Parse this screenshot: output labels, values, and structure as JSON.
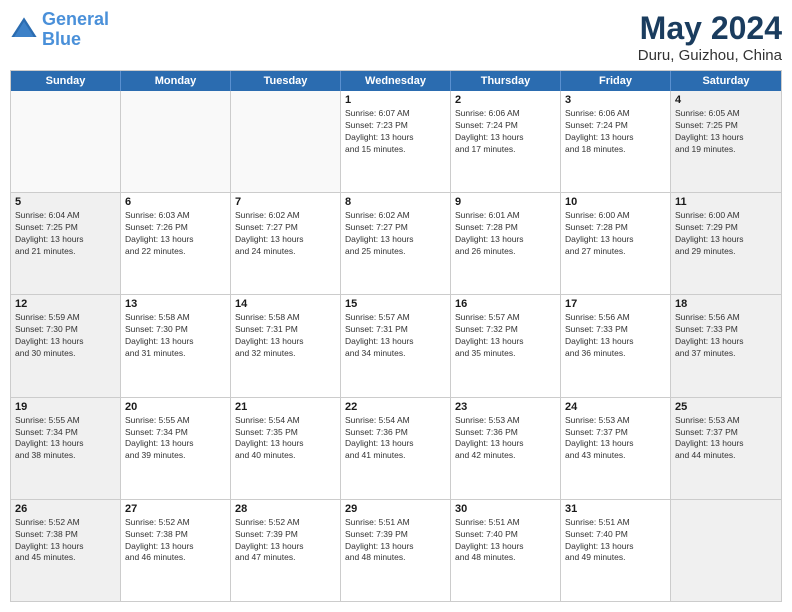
{
  "header": {
    "logo_line1": "General",
    "logo_line2": "Blue",
    "month": "May 2024",
    "location": "Duru, Guizhou, China"
  },
  "weekdays": [
    "Sunday",
    "Monday",
    "Tuesday",
    "Wednesday",
    "Thursday",
    "Friday",
    "Saturday"
  ],
  "rows": [
    [
      {
        "day": "",
        "info": "",
        "shaded": false,
        "empty": true
      },
      {
        "day": "",
        "info": "",
        "shaded": false,
        "empty": true
      },
      {
        "day": "",
        "info": "",
        "shaded": false,
        "empty": true
      },
      {
        "day": "1",
        "info": "Sunrise: 6:07 AM\nSunset: 7:23 PM\nDaylight: 13 hours\nand 15 minutes.",
        "shaded": false,
        "empty": false
      },
      {
        "day": "2",
        "info": "Sunrise: 6:06 AM\nSunset: 7:24 PM\nDaylight: 13 hours\nand 17 minutes.",
        "shaded": false,
        "empty": false
      },
      {
        "day": "3",
        "info": "Sunrise: 6:06 AM\nSunset: 7:24 PM\nDaylight: 13 hours\nand 18 minutes.",
        "shaded": false,
        "empty": false
      },
      {
        "day": "4",
        "info": "Sunrise: 6:05 AM\nSunset: 7:25 PM\nDaylight: 13 hours\nand 19 minutes.",
        "shaded": true,
        "empty": false
      }
    ],
    [
      {
        "day": "5",
        "info": "Sunrise: 6:04 AM\nSunset: 7:25 PM\nDaylight: 13 hours\nand 21 minutes.",
        "shaded": true,
        "empty": false
      },
      {
        "day": "6",
        "info": "Sunrise: 6:03 AM\nSunset: 7:26 PM\nDaylight: 13 hours\nand 22 minutes.",
        "shaded": false,
        "empty": false
      },
      {
        "day": "7",
        "info": "Sunrise: 6:02 AM\nSunset: 7:27 PM\nDaylight: 13 hours\nand 24 minutes.",
        "shaded": false,
        "empty": false
      },
      {
        "day": "8",
        "info": "Sunrise: 6:02 AM\nSunset: 7:27 PM\nDaylight: 13 hours\nand 25 minutes.",
        "shaded": false,
        "empty": false
      },
      {
        "day": "9",
        "info": "Sunrise: 6:01 AM\nSunset: 7:28 PM\nDaylight: 13 hours\nand 26 minutes.",
        "shaded": false,
        "empty": false
      },
      {
        "day": "10",
        "info": "Sunrise: 6:00 AM\nSunset: 7:28 PM\nDaylight: 13 hours\nand 27 minutes.",
        "shaded": false,
        "empty": false
      },
      {
        "day": "11",
        "info": "Sunrise: 6:00 AM\nSunset: 7:29 PM\nDaylight: 13 hours\nand 29 minutes.",
        "shaded": true,
        "empty": false
      }
    ],
    [
      {
        "day": "12",
        "info": "Sunrise: 5:59 AM\nSunset: 7:30 PM\nDaylight: 13 hours\nand 30 minutes.",
        "shaded": true,
        "empty": false
      },
      {
        "day": "13",
        "info": "Sunrise: 5:58 AM\nSunset: 7:30 PM\nDaylight: 13 hours\nand 31 minutes.",
        "shaded": false,
        "empty": false
      },
      {
        "day": "14",
        "info": "Sunrise: 5:58 AM\nSunset: 7:31 PM\nDaylight: 13 hours\nand 32 minutes.",
        "shaded": false,
        "empty": false
      },
      {
        "day": "15",
        "info": "Sunrise: 5:57 AM\nSunset: 7:31 PM\nDaylight: 13 hours\nand 34 minutes.",
        "shaded": false,
        "empty": false
      },
      {
        "day": "16",
        "info": "Sunrise: 5:57 AM\nSunset: 7:32 PM\nDaylight: 13 hours\nand 35 minutes.",
        "shaded": false,
        "empty": false
      },
      {
        "day": "17",
        "info": "Sunrise: 5:56 AM\nSunset: 7:33 PM\nDaylight: 13 hours\nand 36 minutes.",
        "shaded": false,
        "empty": false
      },
      {
        "day": "18",
        "info": "Sunrise: 5:56 AM\nSunset: 7:33 PM\nDaylight: 13 hours\nand 37 minutes.",
        "shaded": true,
        "empty": false
      }
    ],
    [
      {
        "day": "19",
        "info": "Sunrise: 5:55 AM\nSunset: 7:34 PM\nDaylight: 13 hours\nand 38 minutes.",
        "shaded": true,
        "empty": false
      },
      {
        "day": "20",
        "info": "Sunrise: 5:55 AM\nSunset: 7:34 PM\nDaylight: 13 hours\nand 39 minutes.",
        "shaded": false,
        "empty": false
      },
      {
        "day": "21",
        "info": "Sunrise: 5:54 AM\nSunset: 7:35 PM\nDaylight: 13 hours\nand 40 minutes.",
        "shaded": false,
        "empty": false
      },
      {
        "day": "22",
        "info": "Sunrise: 5:54 AM\nSunset: 7:36 PM\nDaylight: 13 hours\nand 41 minutes.",
        "shaded": false,
        "empty": false
      },
      {
        "day": "23",
        "info": "Sunrise: 5:53 AM\nSunset: 7:36 PM\nDaylight: 13 hours\nand 42 minutes.",
        "shaded": false,
        "empty": false
      },
      {
        "day": "24",
        "info": "Sunrise: 5:53 AM\nSunset: 7:37 PM\nDaylight: 13 hours\nand 43 minutes.",
        "shaded": false,
        "empty": false
      },
      {
        "day": "25",
        "info": "Sunrise: 5:53 AM\nSunset: 7:37 PM\nDaylight: 13 hours\nand 44 minutes.",
        "shaded": true,
        "empty": false
      }
    ],
    [
      {
        "day": "26",
        "info": "Sunrise: 5:52 AM\nSunset: 7:38 PM\nDaylight: 13 hours\nand 45 minutes.",
        "shaded": true,
        "empty": false
      },
      {
        "day": "27",
        "info": "Sunrise: 5:52 AM\nSunset: 7:38 PM\nDaylight: 13 hours\nand 46 minutes.",
        "shaded": false,
        "empty": false
      },
      {
        "day": "28",
        "info": "Sunrise: 5:52 AM\nSunset: 7:39 PM\nDaylight: 13 hours\nand 47 minutes.",
        "shaded": false,
        "empty": false
      },
      {
        "day": "29",
        "info": "Sunrise: 5:51 AM\nSunset: 7:39 PM\nDaylight: 13 hours\nand 48 minutes.",
        "shaded": false,
        "empty": false
      },
      {
        "day": "30",
        "info": "Sunrise: 5:51 AM\nSunset: 7:40 PM\nDaylight: 13 hours\nand 48 minutes.",
        "shaded": false,
        "empty": false
      },
      {
        "day": "31",
        "info": "Sunrise: 5:51 AM\nSunset: 7:40 PM\nDaylight: 13 hours\nand 49 minutes.",
        "shaded": false,
        "empty": false
      },
      {
        "day": "",
        "info": "",
        "shaded": true,
        "empty": true
      }
    ]
  ]
}
